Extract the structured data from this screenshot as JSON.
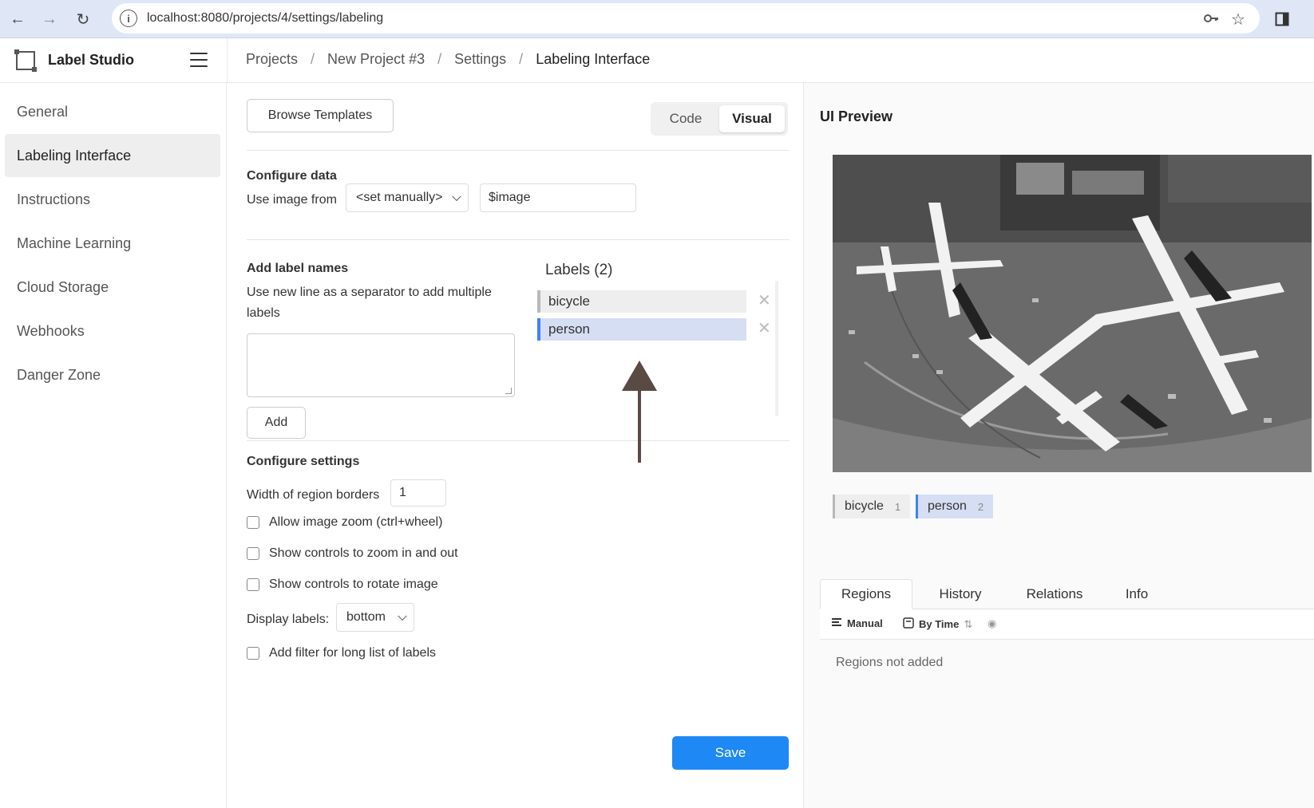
{
  "browser": {
    "url": "localhost:8080/projects/4/settings/labeling"
  },
  "app": {
    "name": "Label Studio"
  },
  "breadcrumb": [
    "Projects",
    "New Project #3",
    "Settings",
    "Labeling Interface"
  ],
  "sidebar": {
    "items": [
      {
        "label": "General",
        "active": false
      },
      {
        "label": "Labeling Interface",
        "active": true
      },
      {
        "label": "Instructions",
        "active": false
      },
      {
        "label": "Machine Learning",
        "active": false
      },
      {
        "label": "Cloud Storage",
        "active": false
      },
      {
        "label": "Webhooks",
        "active": false
      },
      {
        "label": "Danger Zone",
        "active": false
      }
    ]
  },
  "toolbar": {
    "browse_templates": "Browse Templates",
    "code_label": "Code",
    "visual_label": "Visual",
    "active_mode": "Visual"
  },
  "configure_data": {
    "title": "Configure data",
    "use_image_from": "Use image from",
    "source_select": "<set manually>",
    "source_value": "$image"
  },
  "add_labels": {
    "title": "Add label names",
    "hint": "Use new line as a separator to add multiple labels",
    "textarea_value": "",
    "add_button": "Add"
  },
  "labels": {
    "title": "Labels (2)",
    "items": [
      {
        "name": "bicycle",
        "color": "#b8b8b8",
        "bg": "#eeeeee"
      },
      {
        "name": "person",
        "color": "#3b82f6",
        "bg": "#d6def3"
      }
    ]
  },
  "configure_settings": {
    "title": "Configure settings",
    "width_label": "Width of region borders",
    "width_value": "1",
    "options": [
      {
        "label": "Allow image zoom (ctrl+wheel)",
        "checked": false
      },
      {
        "label": "Show controls to zoom in and out",
        "checked": false
      },
      {
        "label": "Show controls to rotate image",
        "checked": false
      }
    ],
    "display_labels_label": "Display labels:",
    "display_labels_value": "bottom",
    "filter_option": {
      "label": "Add filter for long list of labels",
      "checked": false
    }
  },
  "save_button": "Save",
  "preview": {
    "title": "UI Preview",
    "tags": [
      {
        "name": "bicycle",
        "count": "1",
        "color": "#b8b8b8",
        "bg": "#eeeeee"
      },
      {
        "name": "person",
        "count": "2",
        "color": "#3b82f6",
        "bg": "#d6def3"
      }
    ],
    "tabs": [
      "Regions",
      "History",
      "Relations",
      "Info"
    ],
    "active_tab": "Regions",
    "subtabs": {
      "manual": "Manual",
      "by_time": "By Time"
    },
    "empty_message": "Regions not added"
  }
}
